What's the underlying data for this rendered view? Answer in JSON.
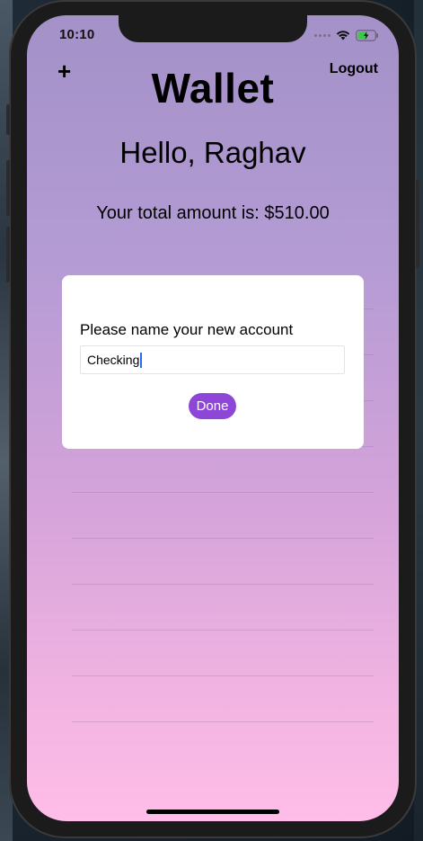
{
  "status_bar": {
    "time": "10:10",
    "icons": [
      "signal-icon",
      "wifi-icon",
      "battery-icon"
    ]
  },
  "header": {
    "add_label": "+",
    "title": "Wallet",
    "logout_label": "Logout"
  },
  "greeting": "Hello, Raghav",
  "total_amount": "Your total amount is: $510.00",
  "modal": {
    "prompt": "Please name your new account",
    "input_value": "Checking",
    "done_label": "Done"
  },
  "colors": {
    "accent": "#8e46d8",
    "gradient_top": "#a391c8",
    "gradient_bottom": "#ffbde8"
  }
}
